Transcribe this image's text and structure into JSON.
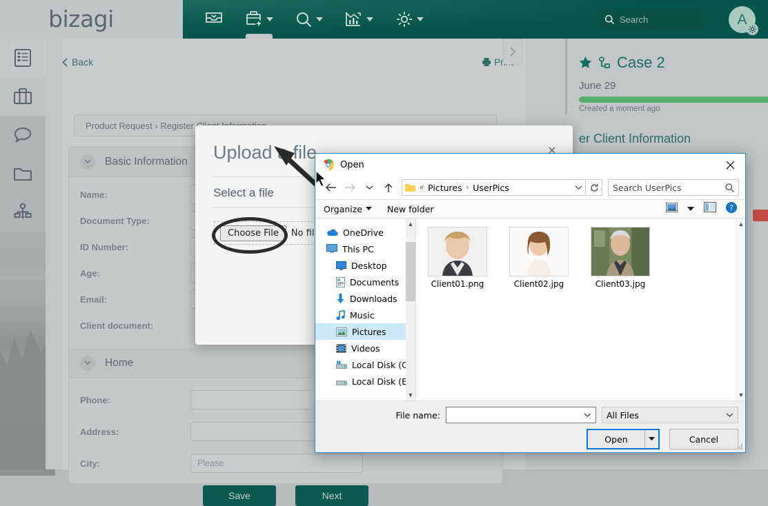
{
  "header": {
    "logo": "bizagi",
    "nav_icons": [
      {
        "name": "inbox-icon",
        "label": "Inbox",
        "has_caret": false,
        "active": false
      },
      {
        "name": "new-case-icon",
        "label": "New case",
        "has_caret": true,
        "active": true
      },
      {
        "name": "search-icon",
        "label": "Search",
        "has_caret": true,
        "active": false
      },
      {
        "name": "analytics-icon",
        "label": "Analytics",
        "has_caret": true,
        "active": false
      },
      {
        "name": "settings-icon",
        "label": "Admin",
        "has_caret": true,
        "active": false
      }
    ],
    "search_placeholder": "Search",
    "avatar_initial": "A",
    "accent_color": "#0a5c52"
  },
  "sidebar": {
    "items": [
      {
        "icon": "list-icon",
        "label": "Tasks"
      },
      {
        "icon": "briefcase-icon",
        "label": "Cases"
      },
      {
        "icon": "chat-icon",
        "label": "Messages"
      },
      {
        "icon": "folder-icon",
        "label": "Documents"
      },
      {
        "icon": "workflow-icon",
        "label": "Processes"
      }
    ]
  },
  "content": {
    "back_label": "Back",
    "print_label": "Print",
    "breadcrumb": "Product Request › Register Client Information",
    "sections": [
      {
        "title": "Basic Information",
        "fields": [
          {
            "label": "Name:",
            "value": ""
          },
          {
            "label": "Document Type:",
            "value": ""
          },
          {
            "label": "ID Number:",
            "value": ""
          },
          {
            "label": "Age:",
            "value": ""
          },
          {
            "label": "Email:",
            "value": ""
          },
          {
            "label": "Client document:",
            "value": ""
          }
        ]
      },
      {
        "title": "Home",
        "fields": [
          {
            "label": "Phone:",
            "value": ""
          },
          {
            "label": "Address:",
            "value": ""
          },
          {
            "label": "City:",
            "value": "Please"
          }
        ]
      }
    ],
    "save_label": "Save",
    "next_label": "Next"
  },
  "case_panel": {
    "title": "Case 2",
    "date": "June 29",
    "created": "Created a moment ago",
    "task": "er Client Information",
    "progress_color": "#57ae70"
  },
  "upload_modal": {
    "title": "Upload a file",
    "select_label": "Select a file",
    "choose_file_label": "Choose File",
    "no_file_text": "No file cho",
    "close_label": "×"
  },
  "open_dialog": {
    "title": "Open",
    "address_prefix": "«",
    "breadcrumbs": [
      "Pictures",
      "UserPics"
    ],
    "search_placeholder": "Search UserPics",
    "toolbar": {
      "organize": "Organize",
      "new_folder": "New folder"
    },
    "tree": [
      {
        "label": "OneDrive",
        "icon": "cloud-icon",
        "level": 0,
        "selected": false
      },
      {
        "label": "This PC",
        "icon": "monitor-icon",
        "level": 0,
        "selected": false
      },
      {
        "label": "Desktop",
        "icon": "desktop-icon",
        "level": 1,
        "selected": false
      },
      {
        "label": "Documents",
        "icon": "documents-icon",
        "level": 1,
        "selected": false
      },
      {
        "label": "Downloads",
        "icon": "download-icon",
        "level": 1,
        "selected": false
      },
      {
        "label": "Music",
        "icon": "music-icon",
        "level": 1,
        "selected": false
      },
      {
        "label": "Pictures",
        "icon": "pictures-icon",
        "level": 1,
        "selected": true
      },
      {
        "label": "Videos",
        "icon": "videos-icon",
        "level": 1,
        "selected": false
      },
      {
        "label": "Local Disk (C:)",
        "icon": "disk-icon",
        "level": 1,
        "selected": false
      },
      {
        "label": "Local Disk (E:)",
        "icon": "disk-icon",
        "level": 1,
        "selected": false
      }
    ],
    "files": [
      {
        "name": "Client01.png",
        "type": "image"
      },
      {
        "name": "Client02.jpg",
        "type": "image"
      },
      {
        "name": "Client03.jpg",
        "type": "image"
      }
    ],
    "file_name_label": "File name:",
    "file_name_value": "",
    "filter_value": "All Files",
    "open_button": "Open",
    "cancel_button": "Cancel"
  }
}
